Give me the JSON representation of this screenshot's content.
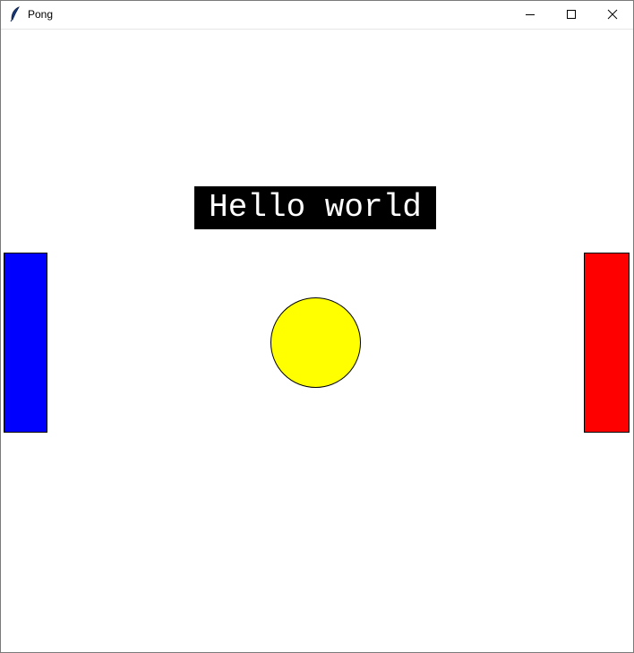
{
  "window": {
    "title": "Pong",
    "icon": "feather-icon",
    "controls": [
      "minimize-icon",
      "maximize-icon",
      "close-icon"
    ]
  },
  "canvas": {
    "background": "#ffffff",
    "text": "Hello world",
    "text_background": "#000000",
    "text_color": "#ffffff",
    "left_paddle_color": "#0000ff",
    "right_paddle_color": "#ff0000",
    "ball_color": "#ffff00"
  }
}
